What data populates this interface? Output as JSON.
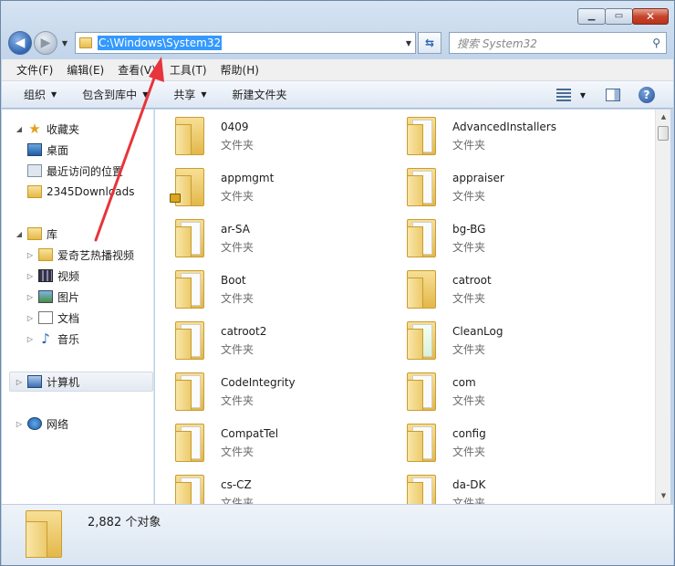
{
  "address": {
    "path": "C:\\Windows\\System32"
  },
  "search": {
    "placeholder": "搜索 System32"
  },
  "menu": [
    "文件(F)",
    "编辑(E)",
    "查看(V)",
    "工具(T)",
    "帮助(H)"
  ],
  "commands": {
    "organize": "组织",
    "include": "包含到库中",
    "share": "共享",
    "new_folder": "新建文件夹"
  },
  "nav": {
    "favorites": "收藏夹",
    "desktop": "桌面",
    "recent": "最近访问的位置",
    "downloads": "2345Downloads",
    "libraries": "库",
    "iqiyi": "爱奇艺热播视频",
    "videos": "视频",
    "pictures": "图片",
    "documents": "文档",
    "music": "音乐",
    "computer": "计算机",
    "network": "网络"
  },
  "items": [
    {
      "name": "0409",
      "type": "文件夹",
      "variant": "plain"
    },
    {
      "name": "AdvancedInstallers",
      "type": "文件夹",
      "variant": "paper"
    },
    {
      "name": "appmgmt",
      "type": "文件夹",
      "variant": "locked"
    },
    {
      "name": "appraiser",
      "type": "文件夹",
      "variant": "paper"
    },
    {
      "name": "ar-SA",
      "type": "文件夹",
      "variant": "paper"
    },
    {
      "name": "bg-BG",
      "type": "文件夹",
      "variant": "paper"
    },
    {
      "name": "Boot",
      "type": "文件夹",
      "variant": "paper"
    },
    {
      "name": "catroot",
      "type": "文件夹",
      "variant": "plain"
    },
    {
      "name": "catroot2",
      "type": "文件夹",
      "variant": "paper"
    },
    {
      "name": "CleanLog",
      "type": "文件夹",
      "variant": "green"
    },
    {
      "name": "CodeIntegrity",
      "type": "文件夹",
      "variant": "paper"
    },
    {
      "name": "com",
      "type": "文件夹",
      "variant": "paper"
    },
    {
      "name": "CompatTel",
      "type": "文件夹",
      "variant": "paper"
    },
    {
      "name": "config",
      "type": "文件夹",
      "variant": "paper"
    },
    {
      "name": "cs-CZ",
      "type": "文件夹",
      "variant": "paper"
    },
    {
      "name": "da-DK",
      "type": "文件夹",
      "variant": "paper"
    }
  ],
  "status": {
    "count": "2,882 个对象"
  },
  "colors": {
    "selection": "#3399ff",
    "annotation_arrow": "#e8343b"
  }
}
